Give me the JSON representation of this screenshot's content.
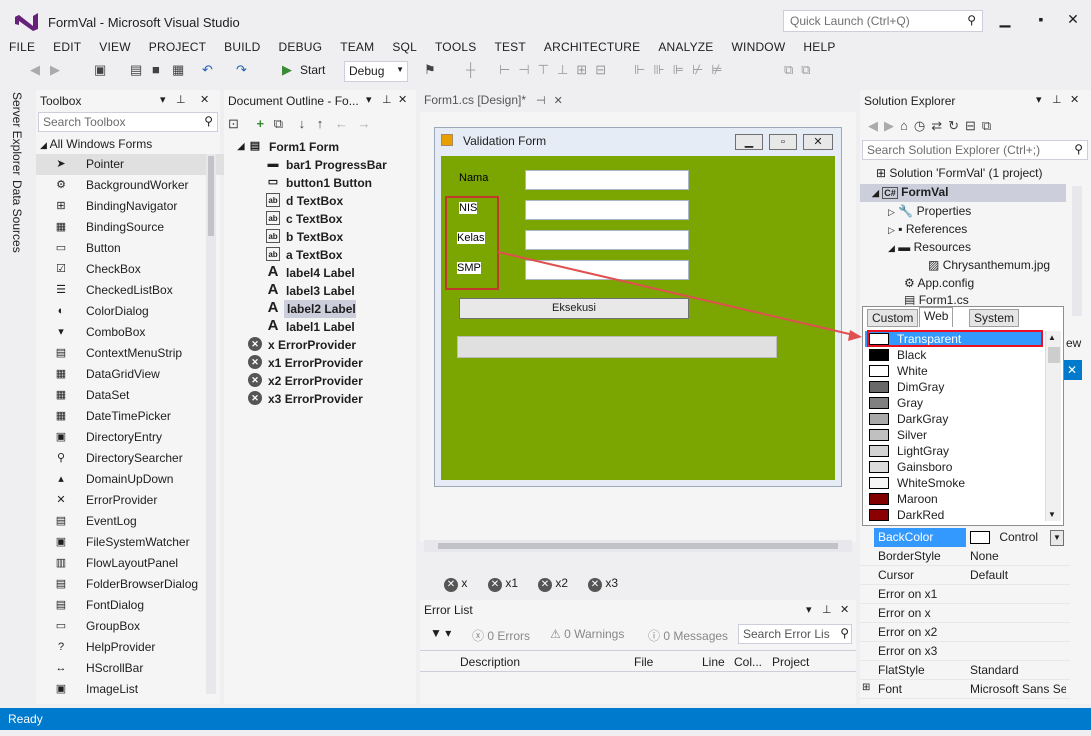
{
  "window": {
    "title": "FormVal - Microsoft Visual Studio",
    "quick_launch": "Quick Launch (Ctrl+Q)"
  },
  "menu": [
    "FILE",
    "EDIT",
    "VIEW",
    "PROJECT",
    "BUILD",
    "DEBUG",
    "TEAM",
    "SQL",
    "TOOLS",
    "TEST",
    "ARCHITECTURE",
    "ANALYZE",
    "WINDOW",
    "HELP"
  ],
  "toolbar": {
    "start_label": "Start",
    "config_value": "Debug"
  },
  "side_tabs": [
    "Server Explorer",
    "Data Sources"
  ],
  "toolbox": {
    "title": "Toolbox",
    "search_placeholder": "Search Toolbox",
    "group": "All Windows Forms",
    "items": [
      "Pointer",
      "BackgroundWorker",
      "BindingNavigator",
      "BindingSource",
      "Button",
      "CheckBox",
      "CheckedListBox",
      "ColorDialog",
      "ComboBox",
      "ContextMenuStrip",
      "DataGridView",
      "DataSet",
      "DateTimePicker",
      "DirectoryEntry",
      "DirectorySearcher",
      "DomainUpDown",
      "ErrorProvider",
      "EventLog",
      "FileSystemWatcher",
      "FlowLayoutPanel",
      "FolderBrowserDialog",
      "FontDialog",
      "GroupBox",
      "HelpProvider",
      "HScrollBar",
      "ImageList"
    ]
  },
  "outline": {
    "title": "Document Outline - Fo...",
    "root": "Form1  Form",
    "items": [
      {
        "name": "bar1",
        "type": "ProgressBar"
      },
      {
        "name": "button1",
        "type": "Button"
      },
      {
        "name": "d",
        "type": "TextBox"
      },
      {
        "name": "c",
        "type": "TextBox"
      },
      {
        "name": "b",
        "type": "TextBox"
      },
      {
        "name": "a",
        "type": "TextBox"
      },
      {
        "name": "label4",
        "type": "Label"
      },
      {
        "name": "label3",
        "type": "Label"
      },
      {
        "name": "label2",
        "type": "Label"
      },
      {
        "name": "label1",
        "type": "Label"
      },
      {
        "name": "x",
        "type": "ErrorProvider"
      },
      {
        "name": "x1",
        "type": "ErrorProvider"
      },
      {
        "name": "x2",
        "type": "ErrorProvider"
      },
      {
        "name": "x3",
        "type": "ErrorProvider"
      }
    ]
  },
  "designer": {
    "tab": "Form1.cs [Design]*",
    "form_title": "Validation Form",
    "labels": [
      "Nama",
      "NIS",
      "Kelas",
      "SMP"
    ],
    "button": "Eksekusi",
    "tray": [
      "x",
      "x1",
      "x2",
      "x3"
    ]
  },
  "errorlist": {
    "title": "Error List",
    "errors": "0 Errors",
    "warnings": "0 Warnings",
    "messages": "0 Messages",
    "search_placeholder": "Search Error Lis",
    "columns": [
      "Description",
      "File",
      "Line",
      "Col...",
      "Project"
    ]
  },
  "solution": {
    "title": "Solution Explorer",
    "search_placeholder": "Search Solution Explorer (Ctrl+;)",
    "items": [
      "Solution 'FormVal' (1 project)",
      "FormVal",
      "Properties",
      "References",
      "Resources",
      "Chrysanthemum.jpg",
      "App.config",
      "Form1.cs"
    ]
  },
  "colorpicker": {
    "tabs": [
      "Custom",
      "Web",
      "System"
    ],
    "selected": "Transparent",
    "colors": [
      {
        "name": "Transparent",
        "hex": "#FFFFFF"
      },
      {
        "name": "Black",
        "hex": "#000000"
      },
      {
        "name": "White",
        "hex": "#FFFFFF"
      },
      {
        "name": "DimGray",
        "hex": "#696969"
      },
      {
        "name": "Gray",
        "hex": "#808080"
      },
      {
        "name": "DarkGray",
        "hex": "#A9A9A9"
      },
      {
        "name": "Silver",
        "hex": "#C0C0C0"
      },
      {
        "name": "LightGray",
        "hex": "#D3D3D3"
      },
      {
        "name": "Gainsboro",
        "hex": "#DCDCDC"
      },
      {
        "name": "WhiteSmoke",
        "hex": "#F5F5F5"
      },
      {
        "name": "Maroon",
        "hex": "#800000"
      },
      {
        "name": "DarkRed",
        "hex": "#8B0000"
      }
    ]
  },
  "properties": [
    {
      "name": "BackColor",
      "value": "Control"
    },
    {
      "name": "BorderStyle",
      "value": "None"
    },
    {
      "name": "Cursor",
      "value": "Default"
    },
    {
      "name": "Error on x1",
      "value": ""
    },
    {
      "name": "Error on x",
      "value": ""
    },
    {
      "name": "Error on x2",
      "value": ""
    },
    {
      "name": "Error on x3",
      "value": ""
    },
    {
      "name": "FlatStyle",
      "value": "Standard"
    },
    {
      "name": "Font",
      "value": "Microsoft Sans Ser"
    }
  ],
  "status": "Ready",
  "colors": {
    "accent": "#007ACC",
    "form_bg": "#7BA500",
    "highlight_red": "#C0392B"
  }
}
